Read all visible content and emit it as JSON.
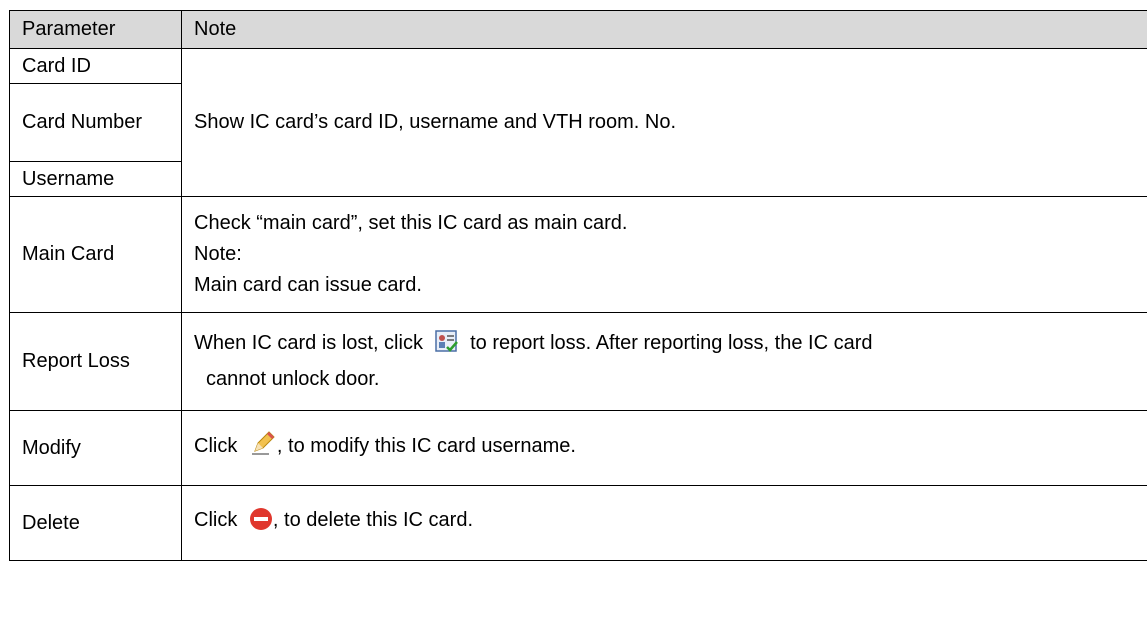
{
  "header": {
    "col1": "Parameter",
    "col2": "Note"
  },
  "rows": {
    "card_id": "Card ID",
    "card_number": "Card Number",
    "username": "Username",
    "group_note": "Show IC card’s card ID, username and VTH room. No.",
    "main_card": {
      "param": "Main Card",
      "line1": "Check “main card”, set this IC card as main card.",
      "line2": "Note:",
      "line3": "Main card can issue card."
    },
    "report_loss": {
      "param": "Report Loss",
      "text_before": "When IC card is lost, click",
      "text_after": "to report loss. After reporting loss, the IC card",
      "line2": "cannot unlock door.",
      "icon": "report-loss-icon"
    },
    "modify": {
      "param": "Modify",
      "text_before": "Click",
      "text_after": ", to modify this IC card username.",
      "icon": "pencil-icon"
    },
    "delete": {
      "param": "Delete",
      "text_before": "Click",
      "text_after": ", to delete this IC card.",
      "icon": "delete-icon"
    }
  }
}
